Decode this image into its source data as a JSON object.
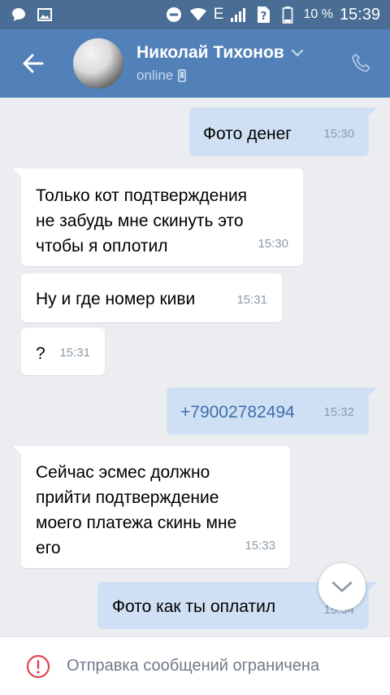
{
  "status_bar": {
    "network": "E",
    "battery": "10 %",
    "time": "15:39"
  },
  "header": {
    "name": "Николай Тихонов",
    "status": "online"
  },
  "messages": [
    {
      "dir": "out",
      "text": "Фото денег",
      "time": "15:30"
    },
    {
      "dir": "in",
      "text": "Только кот подтверждения\nне забудь мне скинуть это\nчтобы я оплотил",
      "time": "15:30"
    },
    {
      "dir": "in",
      "text": "Ну и где номер киви",
      "time": "15:31"
    },
    {
      "dir": "in",
      "text": "?",
      "time": "15:31"
    },
    {
      "dir": "out",
      "text": "+79002782494",
      "time": "15:32"
    },
    {
      "dir": "in",
      "text": "Сейчас эсмес должно\nприйти подтверждение\nмоего платежа скинь мне\nего",
      "time": "15:33"
    },
    {
      "dir": "out",
      "text": "Фото как ты оплатил",
      "time": "15:34"
    }
  ],
  "footer": {
    "restriction_text": "Отправка сообщений ограничена"
  },
  "colors": {
    "accent": "#5181b8",
    "status_bar": "#4a6d95",
    "incoming_bubble": "#ffffff",
    "outgoing_bubble": "#cfe0f5",
    "background": "#ebedf0",
    "warning": "#e0464f"
  }
}
